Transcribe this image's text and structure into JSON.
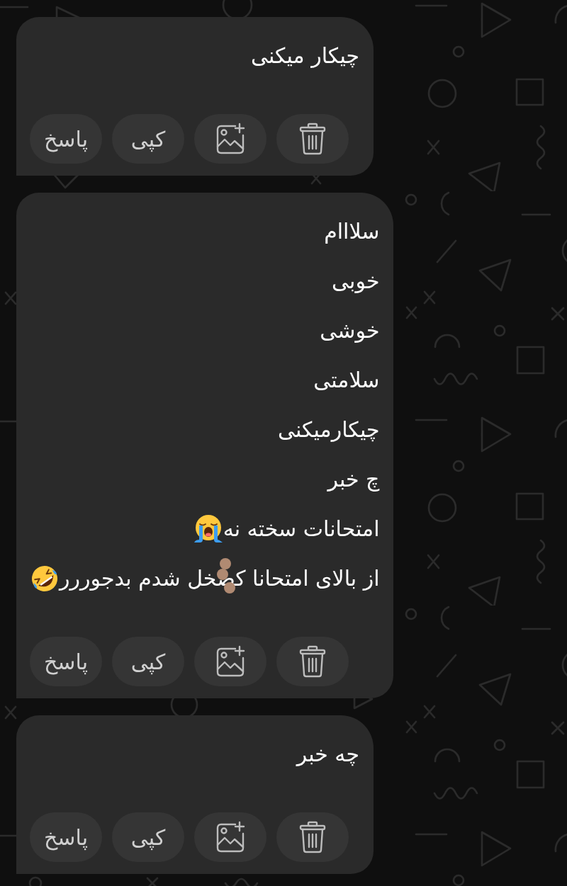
{
  "messages": [
    {
      "lines": [
        {
          "kind": "plain",
          "text": "چیکار میکنی",
          "masked": false
        }
      ],
      "actions": [
        {
          "kind": "delete"
        },
        {
          "kind": "add_image"
        },
        {
          "kind": "copy",
          "label": "کپی"
        },
        {
          "kind": "reply",
          "label": "پاسخ"
        }
      ]
    },
    {
      "lines": [
        {
          "kind": "plain",
          "text": "سلااام",
          "masked": false
        },
        {
          "kind": "plain",
          "text": "خوبی",
          "masked": false
        },
        {
          "kind": "plain",
          "text": "خوشی",
          "masked": false
        },
        {
          "kind": "plain",
          "text": "سلامتی",
          "masked": false
        },
        {
          "kind": "plain",
          "text": "چیکارمیکنی",
          "masked": false
        },
        {
          "kind": "plain",
          "text": "چ خبر",
          "masked": false
        },
        {
          "kind": "crying",
          "text": "امتحانات سخته نه",
          "masked": false
        },
        {
          "kind": "rofl",
          "text": "از بالای امتحانا کصخل شدم بدجوررر",
          "masked": true
        }
      ],
      "actions": [
        {
          "kind": "delete"
        },
        {
          "kind": "add_image"
        },
        {
          "kind": "copy",
          "label": "کپی"
        },
        {
          "kind": "reply",
          "label": "پاسخ"
        }
      ]
    },
    {
      "lines": [
        {
          "kind": "plain",
          "text": "چه خبر",
          "masked": false
        }
      ],
      "actions": [
        {
          "kind": "delete"
        },
        {
          "kind": "add_image"
        },
        {
          "kind": "copy",
          "label": "کپی"
        },
        {
          "kind": "reply",
          "label": "پاسخ"
        }
      ]
    }
  ]
}
